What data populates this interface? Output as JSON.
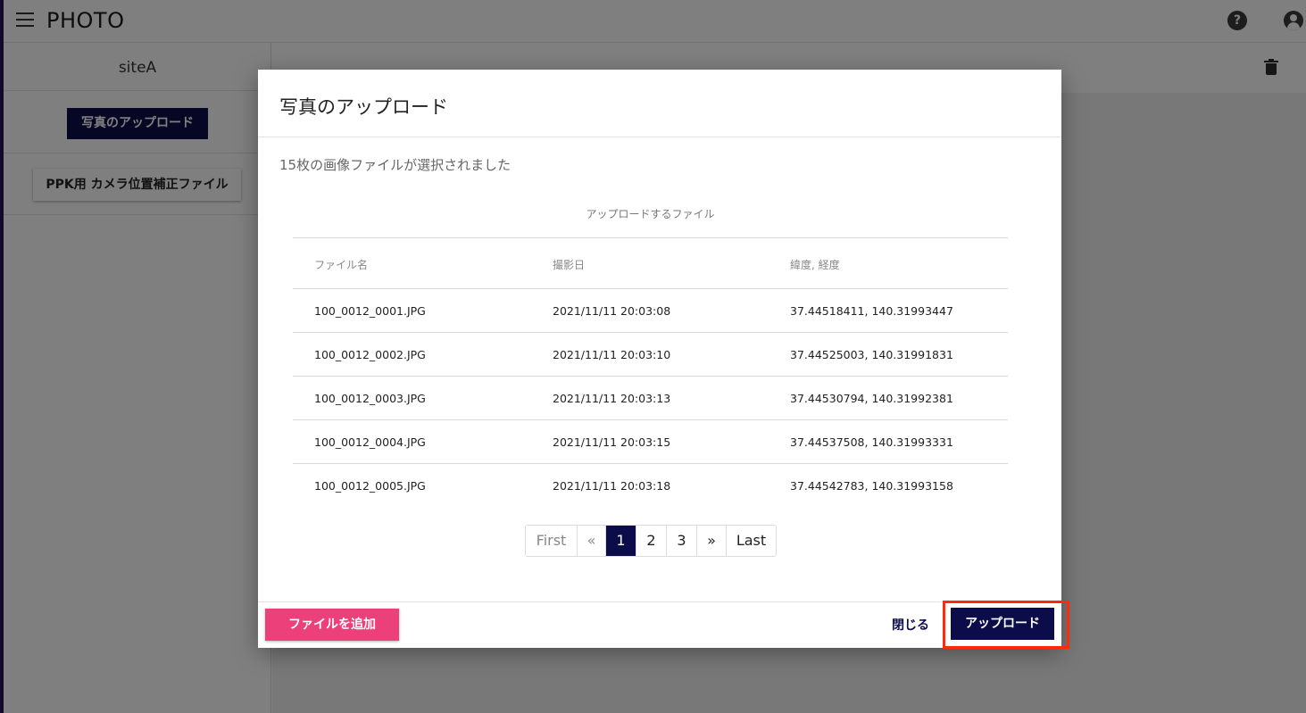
{
  "app": {
    "title": "PHOTO",
    "icons": {
      "menu": "menu-icon",
      "help": "help-icon",
      "account": "account-icon",
      "trash": "trash-icon"
    },
    "help_glyph": "?"
  },
  "sidebar": {
    "site_name": "siteA",
    "upload_photos_label": "写真のアップロード",
    "ppk_label": "PPK用 カメラ位置補正ファイル"
  },
  "modal": {
    "title": "写真のアップロード",
    "selected_message": "15枚の画像ファイルが選択されました",
    "table": {
      "caption": "アップロードするファイル",
      "headers": [
        "ファイル名",
        "撮影日",
        "緯度, 経度"
      ],
      "rows": [
        [
          "100_0012_0001.JPG",
          "2021/11/11 20:03:08",
          "37.44518411, 140.31993447"
        ],
        [
          "100_0012_0002.JPG",
          "2021/11/11 20:03:10",
          "37.44525003, 140.31991831"
        ],
        [
          "100_0012_0003.JPG",
          "2021/11/11 20:03:13",
          "37.44530794, 140.31992381"
        ],
        [
          "100_0012_0004.JPG",
          "2021/11/11 20:03:15",
          "37.44537508, 140.31993331"
        ],
        [
          "100_0012_0005.JPG",
          "2021/11/11 20:03:18",
          "37.44542783, 140.31993158"
        ]
      ]
    },
    "pagination": {
      "first": "First",
      "prev": "«",
      "pages": [
        "1",
        "2",
        "3"
      ],
      "current": "1",
      "next": "»",
      "last": "Last"
    },
    "footer": {
      "add_file_label": "ファイルを追加",
      "close_label": "閉じる",
      "upload_label": "アップロード"
    }
  },
  "colors": {
    "primary": "#0c0c4a",
    "accent_pink": "#ec407a",
    "highlight": "#ff2a0a"
  }
}
